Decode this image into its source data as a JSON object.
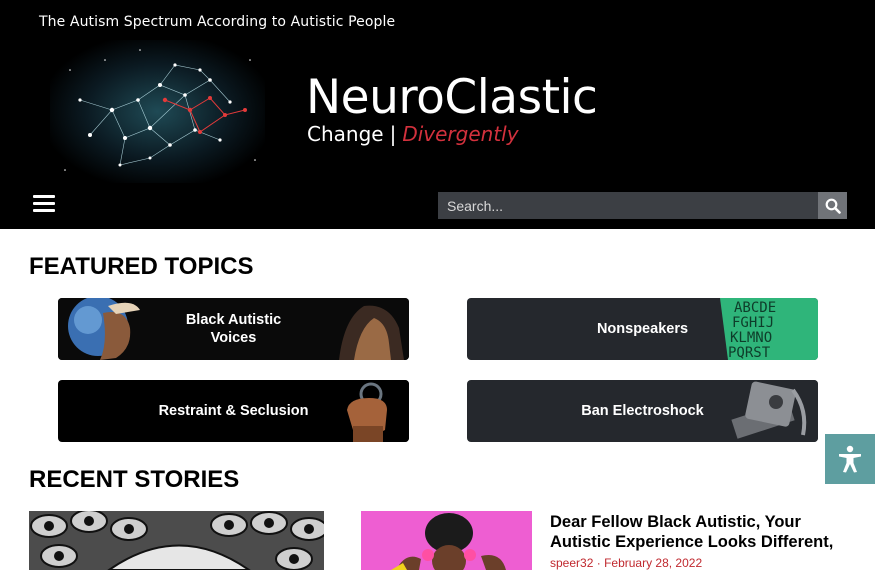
{
  "header": {
    "tagline": "The Autism Spectrum According to Autistic People",
    "brand": "NeuroClastic",
    "subtitle_left": "Change",
    "subtitle_sep": "|",
    "subtitle_right": "Divergently",
    "logo_art": "constellation-network-illustration"
  },
  "nav": {
    "menu_icon": "hamburger-menu-icon",
    "search_placeholder": "Search...",
    "search_icon": "search-icon"
  },
  "featured": {
    "title": "FEATURED TOPICS",
    "topics": [
      {
        "label": "Black Autistic\nVoices",
        "bg": "#0a0a0a"
      },
      {
        "label": "Nonspeakers",
        "bg": "#25282d"
      },
      {
        "label": "Restraint & Seclusion",
        "bg": "#000000"
      },
      {
        "label": "Ban Electroshock",
        "bg": "#25282d"
      }
    ]
  },
  "recent": {
    "title": "RECENT STORIES",
    "story": {
      "title": "Dear Fellow Black Autistic, Your Autistic Experience Looks Different,",
      "author": "speer32",
      "sep": "·",
      "date": "February 28, 2022"
    }
  },
  "accessibility": {
    "icon": "accessibility-icon"
  },
  "colors": {
    "accent_red": "#d3313d",
    "a11y_teal": "#5e9ea0",
    "dark_tile": "#25282d"
  }
}
